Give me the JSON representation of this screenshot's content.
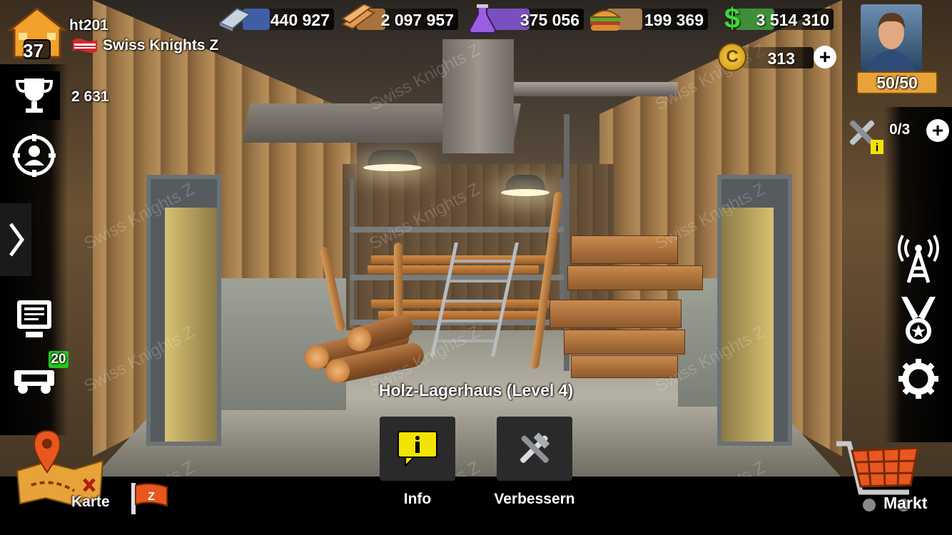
{
  "player": {
    "level": "37",
    "name": "ht201",
    "alliance": "Swiss Knights Z",
    "trophies": "2 631",
    "energy": "50/50"
  },
  "resources": {
    "steel": "440 927",
    "wood": "2 097 957",
    "oil": "375 056",
    "food": "199 369",
    "cash": "3 514 310",
    "coins": "313"
  },
  "builders": {
    "count": "0/3"
  },
  "vehicles_badge": "20",
  "building_label": "Holz-Lagerhaus (Level 4)",
  "actions": {
    "info_label": "Info",
    "upgrade_label": "Verbessern"
  },
  "bottom": {
    "map_label": "Karte",
    "market_label": "Markt",
    "alliance_flag_letter": "Z"
  },
  "watermark_text": "Swiss Knights Z",
  "colors": {
    "steel_fill": "#3f5ea8",
    "wood_fill": "#a8733a",
    "oil_fill": "#7a4fbf",
    "food_fill": "#a47d52",
    "cash_fill": "#3f8f3a",
    "energy_badge": "#e8a23a",
    "info_yellow": "#f2e400",
    "badge_green": "#27c51c"
  },
  "icons": {
    "hq": "hq-building-icon",
    "flag": "alliance-flag-icon",
    "trophy": "trophy-icon",
    "profile": "profile-target-icon",
    "expand": "chevron-right-icon",
    "newspaper": "news-monitor-icon",
    "vehicles": "vehicles-icon",
    "radio": "radio-tower-icon",
    "medal": "medal-icon",
    "settings": "gear-icon",
    "map": "map-pin-icon",
    "market": "shopping-cart-icon",
    "info": "info-speech-icon",
    "upgrade": "hammer-wrench-icon"
  }
}
